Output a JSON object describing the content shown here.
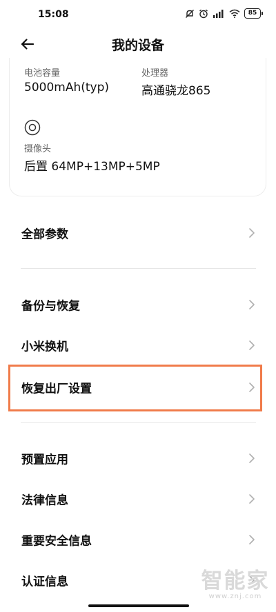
{
  "status_bar": {
    "time": "15:08",
    "battery_level": "85",
    "icons": [
      "mute-icon",
      "alarm-icon",
      "signal-icon",
      "wifi-icon",
      "battery-icon"
    ]
  },
  "header": {
    "title": "我的设备",
    "back_icon": "back-arrow-icon"
  },
  "specs": {
    "battery": {
      "label": "电池容量",
      "value": "5000mAh(typ)"
    },
    "processor": {
      "label": "处理器",
      "value": "高通骁龙865"
    },
    "camera": {
      "label": "摄像头",
      "value": "后置 64MP+13MP+5MP",
      "icon": "camera-icon"
    }
  },
  "menu": {
    "all_params": "全部参数",
    "backup_restore": "备份与恢复",
    "mi_mover": "小米换机",
    "factory_reset": "恢复出厂设置",
    "preinstalled_apps": "预置应用",
    "legal_info": "法律信息",
    "safety_info": "重要安全信息",
    "certification": "认证信息"
  },
  "colors": {
    "highlight": "#f07b4a",
    "divider": "#e6e6e6",
    "chevron": "#b0b0b0"
  },
  "watermark": {
    "text": "智能家",
    "url": "www.znj.com"
  }
}
